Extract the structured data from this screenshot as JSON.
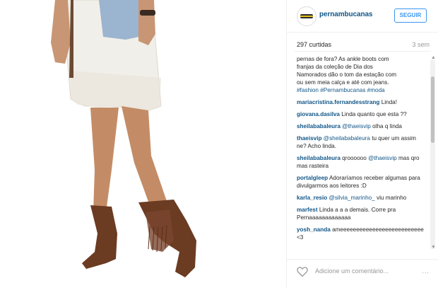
{
  "post": {
    "username": "pernambucanas",
    "follow_label": "SEGUIR",
    "likes": "297 curtidas",
    "time": "3 sem"
  },
  "caption": {
    "lines": [
      "pernas de fora? As ankle boots com",
      "franjas da coleção de Dia dos",
      "Namorados dão o tom da estação com",
      "ou sem meia calça e até com jeans."
    ],
    "hashtags": "#fashion #Pernambucanas #moda"
  },
  "comments": [
    {
      "author": "mariacristina.fernandesstrang",
      "text": "Linda!"
    },
    {
      "author": "giovana.dasilva",
      "text": "Linda quanto que esta ??"
    },
    {
      "author": "sheilababaleura",
      "mention": "@thaeisvip",
      "text": "olha q linda"
    },
    {
      "author": "thaeisvip",
      "mention": "@sheilababaleura",
      "text": "tu quer um assim ne? Acho linda."
    },
    {
      "author": "sheilababaleura",
      "text": "qroooooo",
      "mention2": "@thaeisvip",
      "text2": "mas qro mas rasteira"
    },
    {
      "author": "portalgleep",
      "text": "Adoraríamos receber algumas para divulgarmos aos leitores :D"
    },
    {
      "author": "karla_resio",
      "mention": "@silvia_marinho_",
      "text": "viu marinho"
    },
    {
      "author": "marfest",
      "text": "Linda a a a demais. Corre pra Pernaaaaaaaaaaaaa"
    },
    {
      "author": "yosh_nanda",
      "text": "ameeeeeeeeeeeeeeeeeeeeeeeeee <3"
    }
  ],
  "footer": {
    "add_comment_placeholder": "Adicione um comentário...",
    "more_label": "..."
  },
  "colors": {
    "accent": "#3897f0",
    "link": "#125688",
    "boot": "#6b3b22"
  }
}
